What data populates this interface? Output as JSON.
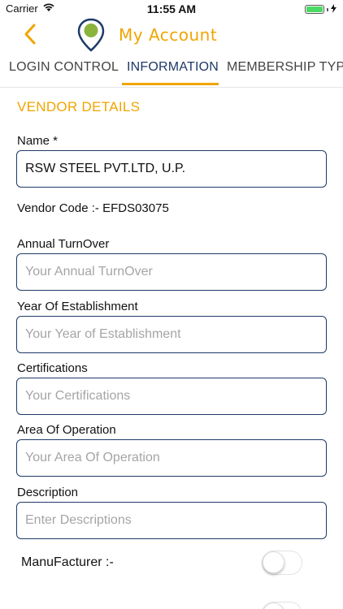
{
  "status_bar": {
    "carrier": "Carrier",
    "time": "11:55 AM",
    "battery_level": 1.0
  },
  "nav": {
    "title": "My Account",
    "back_icon": "chevron-left-icon",
    "logo_icon": "map-pin-logo"
  },
  "tabs": [
    {
      "label": "LOGIN CONTROL",
      "active": false
    },
    {
      "label": "INFORMATION",
      "active": true
    },
    {
      "label": "MEMBERSHIP TYPE",
      "active": false
    }
  ],
  "section": {
    "title": "VENDOR DETAILS"
  },
  "form": {
    "name": {
      "label": "Name *",
      "value": "RSW STEEL PVT.LTD, U.P."
    },
    "vendor_code": "Vendor Code :- EFDS03075",
    "annual_turnover": {
      "label": "Annual TurnOver",
      "placeholder": "Your Annual TurnOver"
    },
    "year_of_establishment": {
      "label": "Year Of Establishment",
      "placeholder": "Your Year of Establishment"
    },
    "certifications": {
      "label": "Certifications",
      "placeholder": "Your Certifications"
    },
    "area_of_operation": {
      "label": "Area Of Operation",
      "placeholder": "Your Area Of Operation"
    },
    "description": {
      "label": "Description",
      "placeholder": "Enter Descriptions"
    },
    "manufacturer": {
      "label": "ManuFacturer :-",
      "on": false
    }
  },
  "colors": {
    "accent": "#f0a500",
    "border": "#1e3a68",
    "logo_dot": "#8ab43c"
  }
}
